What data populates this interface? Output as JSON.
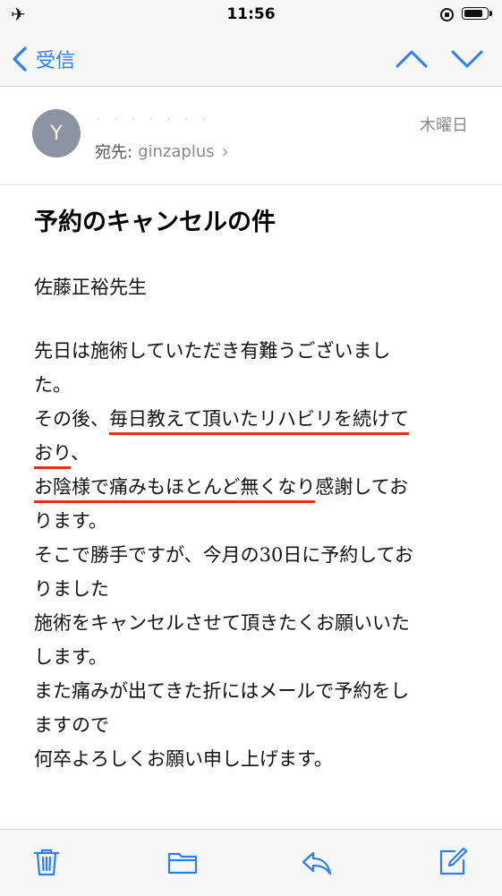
{
  "status_bar": {
    "time": "11:56",
    "airplane_icon": "airplane-icon",
    "battery_level": 0.85
  },
  "nav": {
    "back_label": "受信"
  },
  "header": {
    "avatar_initial": "Y",
    "date": "木曜日",
    "to_label": "宛先:",
    "to_value": "ginzaplus",
    "sender_hidden": "· · · · · · ·"
  },
  "subject": "予約のキャンセルの件",
  "body": {
    "greeting": "佐藤正裕先生",
    "l1": "先日は施術していただき有難うございまし",
    "l2": "た。",
    "l3_pre": "その後、",
    "l3_ul": "毎日教えて頂いたリハビリを続けて",
    "l4_ul": "おり",
    "l4_post": "、",
    "l5_ul": "お陰様で痛みもほとんど無くなり",
    "l5_post": "感謝してお",
    "l6": "ります。",
    "l7": "そこで勝手ですが、今月の30日に予約してお",
    "l8": "りました",
    "l9": "施術をキャンセルさせて頂きたくお願いいた",
    "l10": "します。",
    "l11": "また痛みが出てきた折にはメールで予約をし",
    "l12": "ますので",
    "l13": "何卒よろしくお願い申し上げます。"
  },
  "accent_color": "#2c7ef5",
  "underline_color": "#e0321e"
}
